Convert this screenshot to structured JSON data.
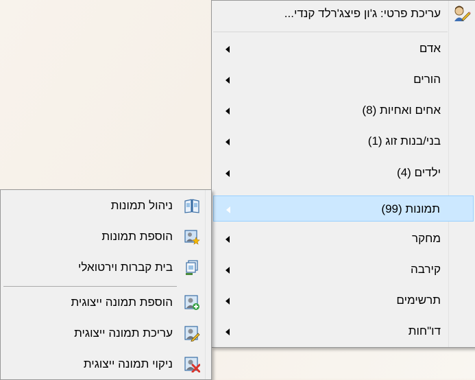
{
  "main_menu": {
    "header": {
      "label": "עריכת פרטי: ג'ון פיצג'רלד קנדי...",
      "icon": "person-edit-icon"
    },
    "items": [
      {
        "label": "אדם"
      },
      {
        "label": "הורים"
      },
      {
        "label": "אחים ואחיות (8)"
      },
      {
        "label": "בני/בנות זוג (1)"
      },
      {
        "label": "ילדים (4)"
      },
      {
        "label": "תמונות (99)",
        "highlighted": true
      },
      {
        "label": "מחקר"
      },
      {
        "label": "קירבה"
      },
      {
        "label": "תרשימים"
      },
      {
        "label": "דו\"חות"
      }
    ]
  },
  "photos_submenu": {
    "items": [
      {
        "label": "ניהול תמונות",
        "icon": "photo-album-icon"
      },
      {
        "label": "הוספת תמונות",
        "icon": "add-photos-icon"
      },
      {
        "label": "בית קברות וירטואלי",
        "icon": "virtual-cemetery-icon"
      },
      {
        "label": "הוספת תמונה ייצוגית",
        "icon": "add-portrait-icon"
      },
      {
        "label": "עריכת תמונה ייצוגית",
        "icon": "edit-portrait-icon"
      },
      {
        "label": "ניקוי תמונה ייצוגית",
        "icon": "clear-portrait-icon"
      }
    ]
  },
  "colors": {
    "highlight": "#cce8ff",
    "highlight_border": "#99d1ff",
    "menu_bg": "#f0f0f0"
  }
}
